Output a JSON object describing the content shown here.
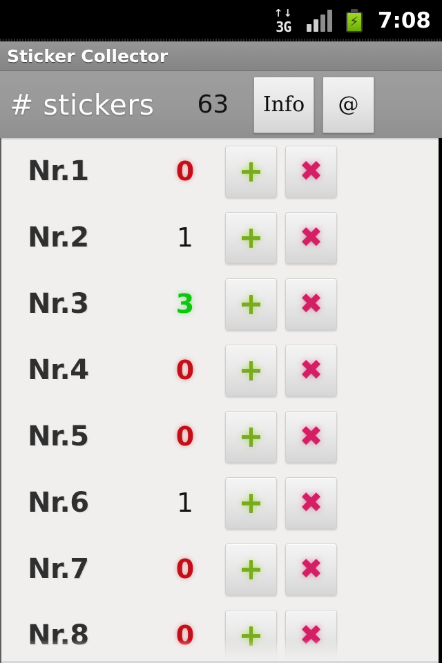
{
  "status_bar": {
    "network_arrows": "↑↓",
    "network_type": "3G",
    "battery_bolt": "⚡",
    "time": "7:08"
  },
  "title_bar": {
    "app_title": "Sticker Collector"
  },
  "header": {
    "label": "# stickers",
    "count": "63",
    "info_button": "Info",
    "at_button": "@"
  },
  "list": {
    "plus_glyph": "+",
    "cross_glyph": "✖",
    "rows": [
      {
        "label": "Nr.1",
        "count": "0"
      },
      {
        "label": "Nr.2",
        "count": "1"
      },
      {
        "label": "Nr.3",
        "count": "3"
      },
      {
        "label": "Nr.4",
        "count": "0"
      },
      {
        "label": "Nr.5",
        "count": "0"
      },
      {
        "label": "Nr.6",
        "count": "1"
      },
      {
        "label": "Nr.7",
        "count": "0"
      },
      {
        "label": "Nr.8",
        "count": "0"
      }
    ]
  },
  "colors": {
    "zero_red": "#c0101b",
    "positive_black": "#141414",
    "many_green": "#12c412",
    "plus_green": "#78ab1f",
    "cross_pink": "#d31f63",
    "chrome_gray": "#989898",
    "list_bg": "#f0efed"
  }
}
